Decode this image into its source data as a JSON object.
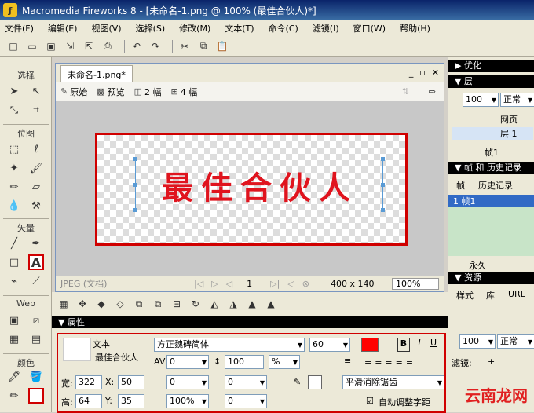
{
  "window": {
    "title": "Macromedia Fireworks 8 - [未命名-1.png @ 100% (最佳合伙人)*]"
  },
  "menu": [
    "文件(F)",
    "编辑(E)",
    "视图(V)",
    "选择(S)",
    "修改(M)",
    "文本(T)",
    "命令(C)",
    "滤镜(I)",
    "窗口(W)",
    "帮助(H)"
  ],
  "tools": {
    "select": "选择",
    "bitmap": "位图",
    "vector": "矢量",
    "web": "Web",
    "colors": "颜色",
    "text_tool": "A"
  },
  "document": {
    "tab": "未命名-1.png*",
    "views": {
      "original": "原始",
      "preview": "预览",
      "two_up": "2 幅",
      "four_up": "4 幅"
    },
    "text": "最佳合伙人",
    "status_format": "JPEG (文档)",
    "frame_number": "1",
    "canvas_size": "400 x 140",
    "zoom": "100%"
  },
  "properties": {
    "title": "属性",
    "type": "文本",
    "name": "最佳合伙人",
    "font": "方正魏碑简体",
    "size": "60",
    "color": "#ff0000",
    "kerning": "0",
    "leading": "100",
    "leading_unit": "%",
    "indent": "0",
    "space_before": "0",
    "space_after": "0",
    "scale": "100%",
    "baseline": "0",
    "w": "322",
    "x": "50",
    "h": "64",
    "y": "35",
    "w_label": "宽:",
    "h_label": "高:",
    "x_label": "X:",
    "y_label": "Y:",
    "antialias": "平滑消除锯齿",
    "auto_kern": "自动调整字距",
    "bold": "B",
    "italic": "I",
    "underline": "U"
  },
  "right": {
    "optimize": "优化",
    "layers": "层",
    "opacity": "100",
    "blend": "正常",
    "layer_web": "网页",
    "layer_1": "层 1",
    "frame_label": "帧1",
    "frames_history": "帧 和 历史记录",
    "tab_frames": "帧",
    "tab_history": "历史记录",
    "frame_row": "1  帧1",
    "forever": "永久",
    "assets": "资源",
    "tab_styles": "样式",
    "tab_library": "库",
    "tab_url": "URL",
    "opacity2": "100",
    "blend2": "正常",
    "filters": "滤镜:"
  },
  "watermark": "云南龙网"
}
